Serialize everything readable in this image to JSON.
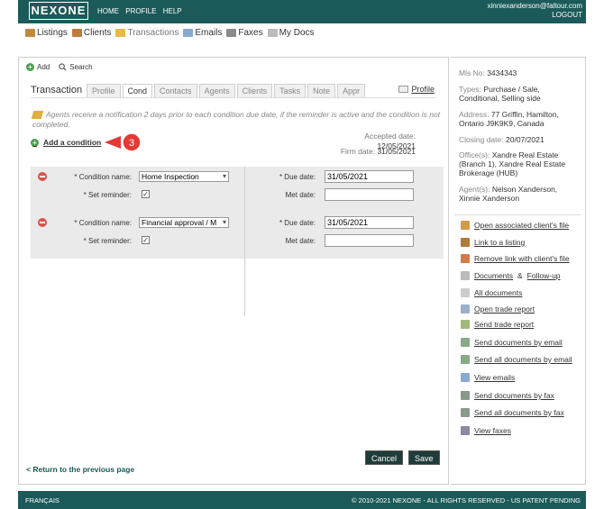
{
  "header": {
    "logo": "NEXONE",
    "nav": [
      "HOME",
      "PROFILE",
      "HELP"
    ],
    "user_email": "xinniexanderson@faltour.com",
    "logout": "LOGOUT"
  },
  "main_nav": [
    {
      "label": "Listings",
      "icon": "house-icon",
      "color": "#c08a3e"
    },
    {
      "label": "Clients",
      "icon": "clients-icon",
      "color": "#c07a3a"
    },
    {
      "label": "Transactions",
      "icon": "folder-icon",
      "color": "#e8b84a"
    },
    {
      "label": "Emails",
      "icon": "envelope-icon",
      "color": "#8aa9d0"
    },
    {
      "label": "Faxes",
      "icon": "fax-icon",
      "color": "#8a8a8a"
    },
    {
      "label": "My Docs",
      "icon": "docs-icon",
      "color": "#bbbbbb"
    }
  ],
  "toolbar": {
    "add": "Add",
    "search": "Search"
  },
  "tabs_label": "Transaction",
  "tabs": [
    "Profile",
    "Cond",
    "Contacts",
    "Agents",
    "Clients",
    "Tasks",
    "Note",
    "Appr"
  ],
  "active_tab": "Cond",
  "profile_link": "Profile",
  "notice": "Agents receive a notification 2 days prior to each condition due date, if the reminder is active and the condition is not completed.",
  "add_condition": "Add a condition",
  "callout_number": "3",
  "accepted_label": "Accepted date:",
  "accepted_value": "12/05/2021",
  "firm_label": "Firm date:",
  "firm_value": "31/05/2021",
  "conditions": [
    {
      "name_label": "* Condition name:",
      "name_value": "Home Inspection",
      "reminder_label": "* Set reminder:",
      "due_label": "* Due date:",
      "due_value": "31/05/2021",
      "met_label": "Met date:",
      "met_value": ""
    },
    {
      "name_label": "* Condition name:",
      "name_value": "Financial approval / M",
      "reminder_label": "* Set reminder:",
      "due_label": "* Due date:",
      "due_value": "31/05/2021",
      "met_label": "Met date:",
      "met_value": ""
    }
  ],
  "buttons": {
    "cancel": "Cancel",
    "save": "Save"
  },
  "back_link": "< Return to the previous page",
  "info": {
    "mls_label": "Mls No:",
    "mls_value": "3434343",
    "types_label": "Types:",
    "types_value": "Purchase / Sale, Conditional, Selling side",
    "address_label": "Address:",
    "address_value": "77 Griffin, Hamilton, Ontario J9K9K9, Canada",
    "closing_label": "Closing date:",
    "closing_value": "20/07/2021",
    "offices_label": "Office(s):",
    "offices_value": "Xandre Real Estate (Branch 1), Xandre Real Estate Brokerage (HUB)",
    "agents_label": "Agent(s):",
    "agents_value": "Nelson Xanderson, Xinnie Xanderson"
  },
  "actions": [
    {
      "label": "Open associated client's file",
      "icon": "client-file-icon",
      "color": "#d49a4a"
    },
    {
      "label": "Link to a listing",
      "icon": "house-link-icon",
      "color": "#b07a3a"
    },
    {
      "label": "Remove link with client's file",
      "icon": "client-unlink-icon",
      "color": "#d47a4a"
    },
    {
      "label": "Documents",
      "label2": "Follow-up",
      "joiner": "&",
      "icon": "document-icon",
      "color": "#bbbbbb"
    },
    {
      "label": "All documents",
      "icon": "all-documents-icon",
      "color": "#cccccc"
    },
    {
      "label": "Open trade report",
      "icon": "trade-report-icon",
      "color": "#9ab0cc"
    },
    {
      "label": "Send trade report",
      "icon": "send-report-icon",
      "color": "#a0b878"
    },
    {
      "label": "Send documents by email",
      "icon": "email-send-icon",
      "color": "#88aa88"
    },
    {
      "label": "Send all documents by email",
      "icon": "email-send-all-icon",
      "color": "#88aa88"
    },
    {
      "label": "View emails",
      "icon": "view-emails-icon",
      "color": "#8aa9d0"
    },
    {
      "label": "Send documents by fax",
      "icon": "fax-send-icon",
      "color": "#8a9a8a"
    },
    {
      "label": "Send all documents by fax",
      "icon": "fax-send-all-icon",
      "color": "#8a9a8a"
    },
    {
      "label": "View faxes",
      "icon": "view-faxes-icon",
      "color": "#8a8aa0"
    }
  ],
  "footer": {
    "left": "FRANÇAIS",
    "right": "© 2010-2021 NEXONE - ALL RIGHTS RESERVED - US PATENT PENDING"
  }
}
